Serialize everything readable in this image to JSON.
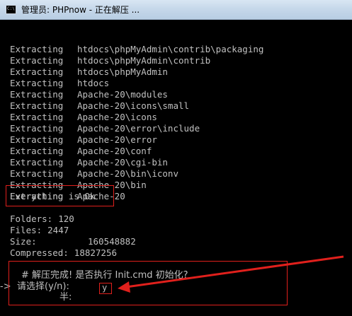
{
  "window": {
    "title": "管理员: PHPnow - 正在解压 ..."
  },
  "console": {
    "lines": [
      {
        "action": "Extracting",
        "path": "htdocs\\phpMyAdmin\\contrib\\packaging"
      },
      {
        "action": "Extracting",
        "path": "htdocs\\phpMyAdmin\\contrib"
      },
      {
        "action": "Extracting",
        "path": "htdocs\\phpMyAdmin"
      },
      {
        "action": "Extracting",
        "path": "htdocs"
      },
      {
        "action": "Extracting",
        "path": "Apache-20\\modules"
      },
      {
        "action": "Extracting",
        "path": "Apache-20\\icons\\small"
      },
      {
        "action": "Extracting",
        "path": "Apache-20\\icons"
      },
      {
        "action": "Extracting",
        "path": "Apache-20\\error\\include"
      },
      {
        "action": "Extracting",
        "path": "Apache-20\\error"
      },
      {
        "action": "Extracting",
        "path": "Apache-20\\conf"
      },
      {
        "action": "Extracting",
        "path": "Apache-20\\cgi-bin"
      },
      {
        "action": "Extracting",
        "path": "Apache-20\\bin\\iconv"
      },
      {
        "action": "Extracting",
        "path": "Apache-20\\bin"
      },
      {
        "action": "Extracting",
        "path": "Apache-20"
      }
    ],
    "status": "Everything is Ok",
    "stats": [
      {
        "label": "Folders:",
        "value": "120"
      },
      {
        "label": "Files:",
        "value": "2447"
      },
      {
        "label": "Size:",
        "value": "160548882"
      },
      {
        "label": "Compressed:",
        "value": "18827256"
      }
    ],
    "prompt_question": "# 解压完成! 是否执行 Init.cmd 初始化?",
    "prompt_arrow": "->",
    "prompt_select": "请选择(y/n):",
    "input_value": "y",
    "trailing_text": "半:"
  },
  "colors": {
    "console_bg": "#000000",
    "console_text": "#c0c0c0",
    "annotation": "#e0201c"
  },
  "icons": {
    "app": "console-app-icon"
  }
}
